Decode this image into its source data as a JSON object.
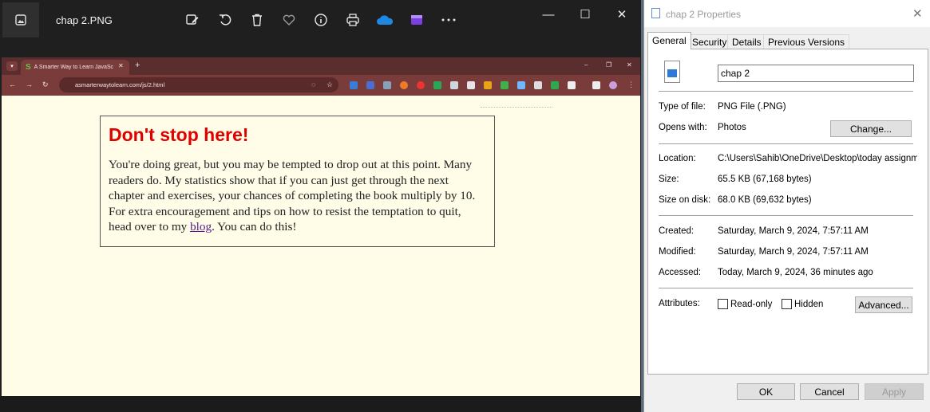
{
  "photos": {
    "title": "chap 2.PNG",
    "icons": [
      "gallery-icon",
      "edit-icon",
      "rotate-icon",
      "delete-icon",
      "heart-icon",
      "info-icon",
      "print-icon",
      "onedrive-icon",
      "clipchamp-icon",
      "more-icon"
    ],
    "window_controls": {
      "minimize": "—",
      "maximize": "☐",
      "close": "✕"
    }
  },
  "browser": {
    "tab_title": "A Smarter Way to Learn JavaSc",
    "tab_close": "✕",
    "new_tab": "+",
    "url": "asmarterwaytolearn.com/js/2.html",
    "window_controls": {
      "minimize": "–",
      "maximize": "❐",
      "close": "✕"
    }
  },
  "content": {
    "heading": "Don't stop here!",
    "paragraph_before_link": "You're doing great, but you may be tempted to drop out at this point. Many readers do. My statistics show that if you can just get through the next chapter and exercises, your chances of completing the book multiply by 10. For extra encouragement and tips on how to resist the temptation to quit, head over to my ",
    "link_text": "blog",
    "paragraph_after_link": ". You can do this!"
  },
  "properties": {
    "title": "chap 2 Properties",
    "tabs": [
      "General",
      "Security",
      "Details",
      "Previous Versions"
    ],
    "file_name": "chap 2",
    "type_of_file_label": "Type of file:",
    "type_of_file": "PNG File (.PNG)",
    "opens_with_label": "Opens with:",
    "opens_with": "Photos",
    "change_button": "Change...",
    "location_label": "Location:",
    "location": "C:\\Users\\Sahib\\OneDrive\\Desktop\\today assignme",
    "size_label": "Size:",
    "size": "65.5 KB (67,168 bytes)",
    "size_on_disk_label": "Size on disk:",
    "size_on_disk": "68.0 KB (69,632 bytes)",
    "created_label": "Created:",
    "created": "Saturday, March 9, 2024, 7:57:11 AM",
    "modified_label": "Modified:",
    "modified": "Saturday, March 9, 2024, 7:57:11 AM",
    "accessed_label": "Accessed:",
    "accessed": "Today, March 9, 2024, 36 minutes ago",
    "attributes_label": "Attributes:",
    "readonly_label": "Read-only",
    "hidden_label": "Hidden",
    "advanced_button": "Advanced...",
    "ok_button": "OK",
    "cancel_button": "Cancel",
    "apply_button": "Apply"
  },
  "colors": {
    "heading": "#e00000",
    "page_bg": "#fffde8",
    "chrome_bar": "#7a3b3b",
    "viewer_bg": "#1f1f1f"
  }
}
